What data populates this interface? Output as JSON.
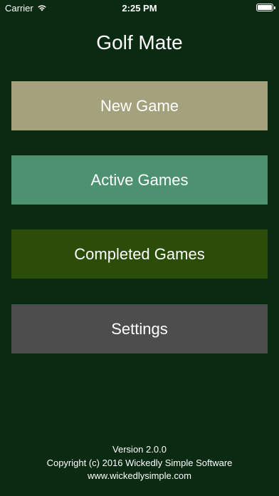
{
  "status_bar": {
    "carrier": "Carrier",
    "time": "2:25 PM",
    "battery_level": 1.0
  },
  "app": {
    "title": "Golf Mate"
  },
  "menu": [
    {
      "label": "New Game",
      "color": "#a3a27c"
    },
    {
      "label": "Active Games",
      "color": "#4d9270"
    },
    {
      "label": "Completed Games",
      "color": "#2b4d08"
    },
    {
      "label": "Settings",
      "color": "#4d4d4d"
    }
  ],
  "footer": {
    "version": "Version 2.0.0",
    "copyright": "Copyright (c) 2016 Wickedly Simple Software",
    "website": "www.wickedlysimple.com"
  },
  "colors": {
    "background": "#0b2a12",
    "text": "#ffffff"
  }
}
